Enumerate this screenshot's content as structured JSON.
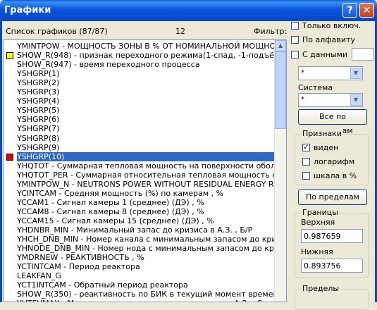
{
  "window": {
    "title": "Графики",
    "help_label": "?",
    "close_label": "✕"
  },
  "list_header": {
    "label": "Список графиков (87/87)",
    "number": "12",
    "filter_label": "Фильтр:"
  },
  "list": [
    {
      "text": "YMINTPOW - МОЩНОСТЬ ЗОНЫ В % ОТ НОМИНАЛЬНОЙ МОЩНОСТИ",
      "mark": ""
    },
    {
      "text": "SHOW_R(948) - признак переходного режима(1-спад, -1-подъём, 0 - выход",
      "mark": "#ffff00"
    },
    {
      "text": "SHOW_R(947) - время переходного процесса",
      "mark": ""
    },
    {
      "text": "YSHGRP(1)",
      "mark": ""
    },
    {
      "text": "YSHGRP(2)",
      "mark": ""
    },
    {
      "text": "YSHGRP(3)",
      "mark": ""
    },
    {
      "text": "YSHGRP(4)",
      "mark": ""
    },
    {
      "text": "YSHGRP(5)",
      "mark": ""
    },
    {
      "text": "YSHGRP(6)",
      "mark": ""
    },
    {
      "text": "YSHGRP(7)",
      "mark": ""
    },
    {
      "text": "YSHGRP(8)",
      "mark": ""
    },
    {
      "text": "YSHGRP(9)",
      "mark": ""
    },
    {
      "text": "YSHGRP(10)",
      "mark": "#e00000",
      "selected": true
    },
    {
      "text": "YHQTOT - Суммарная тепловая мощность на поверхности оболочек твэл",
      "mark": ""
    },
    {
      "text": "YHQTOT_PER - Суммарная относительная тепловая мощность на поверх",
      "mark": ""
    },
    {
      "text": "YMINTPOW_N - NEUTRONS POWER WITHOUT RESIDUAL ENERGY RE",
      "mark": ""
    },
    {
      "text": "YCINTCAM - Средняя мощность (%) по камерам , %",
      "mark": ""
    },
    {
      "text": "YCCAM1 - Сигнал камеры 1 (среднее) (ДЭ) , %",
      "mark": ""
    },
    {
      "text": "YCCAM8 - Сигнал камеры 8 (среднее) (ДЭ) , %",
      "mark": ""
    },
    {
      "text": "YCCAM15 - Сигнал камеры 15 (среднее) (ДЭ) , %",
      "mark": ""
    },
    {
      "text": "YHDNBR_MIN - Минимальный запас до кризиса в А.З. , Б/Р",
      "mark": ""
    },
    {
      "text": "YHCH_DNB_MIN - Номер канала с минимальным запасом до кризиса",
      "mark": ""
    },
    {
      "text": "YHNODE_DNB_MIN - Номер нода с минимальным запасом до кризиса",
      "mark": ""
    },
    {
      "text": "YMDRNEW - РЕАКТИВНОСТЬ , %",
      "mark": ""
    },
    {
      "text": "YCTINTCAM - Период реактора",
      "mark": ""
    },
    {
      "text": "LEAKFAN_G",
      "mark": ""
    },
    {
      "text": "YCT1INTCAM - Обратный период реактора",
      "mark": ""
    },
    {
      "text": "SHOW_R(350) - реактивность по БИК в текущий момент времени,центы",
      "mark": ""
    },
    {
      "text": "YHTFUMAX - Максимальная температура топлива по А.З. , С",
      "mark": ""
    }
  ],
  "right": {
    "only_enabled": "Только включ.",
    "alphabetical": "По алфавиту",
    "with_data": "С данными",
    "combo1_value": "*",
    "system_label": "Система",
    "combo2_value": "*",
    "all_by_limits_btn": "Все по пределам",
    "features_group": "Признаки",
    "visible_label": "виден",
    "log_label": "логарифм",
    "scale_pct_label": "шкала в %",
    "by_limits_btn": "По пределам",
    "bounds_group": "Границы",
    "upper_label": "Верхняя",
    "upper_value": "0.987659",
    "lower_label": "Нижняя",
    "lower_value": "0.893756",
    "limits_group": "Пределы"
  }
}
